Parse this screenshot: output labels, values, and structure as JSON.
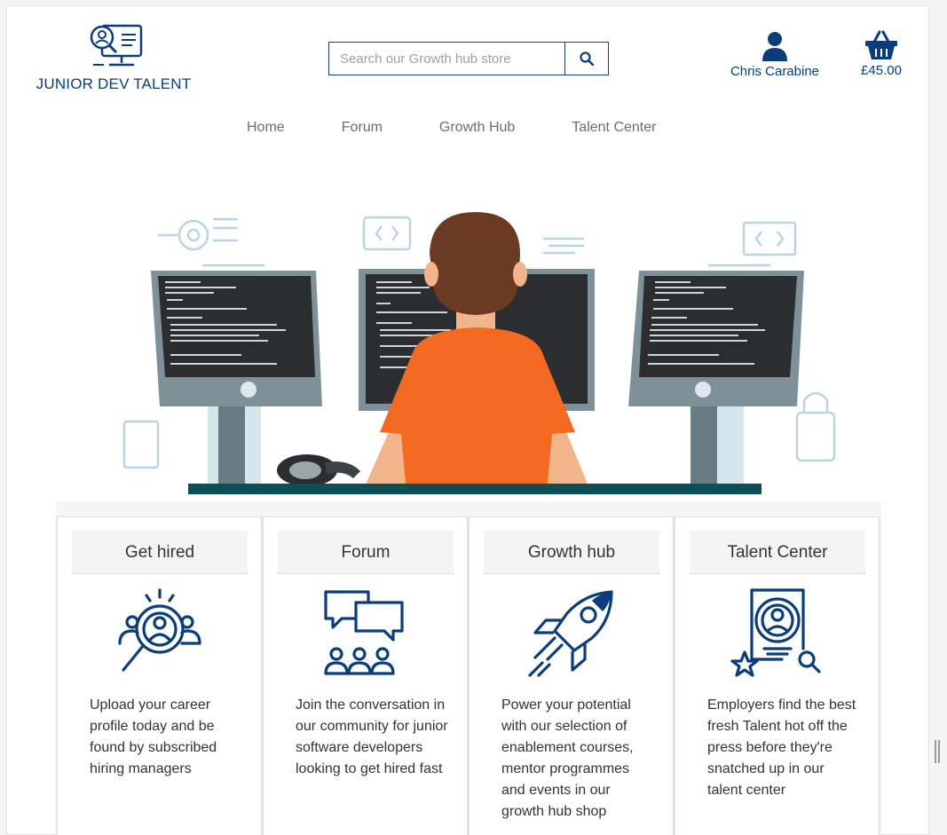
{
  "brand": {
    "name": "JUNIOR DEV TALENT",
    "color": "#0a3d7a"
  },
  "search": {
    "placeholder": "Search our Growth hub store"
  },
  "account": {
    "name": "Chris Carabine"
  },
  "basket": {
    "total": "£45.00"
  },
  "nav": [
    "Home",
    "Forum",
    "Growth Hub",
    "Talent Center"
  ],
  "cards": [
    {
      "title": "Get hired",
      "icon": "search-people-icon",
      "text": "Upload your career profile today and be found by subscribed hiring managers"
    },
    {
      "title": "Forum",
      "icon": "discussion-icon",
      "text": "Join the conversation in our community for junior software developers looking to get hired fast"
    },
    {
      "title": "Growth hub",
      "icon": "rocket-icon",
      "text": "Power your potential with our selection of enablement courses, mentor programmes and events in our growth hub shop"
    },
    {
      "title": "Talent Center",
      "icon": "talent-badge-icon",
      "text": "Employers find the best fresh Talent hot off the press before they're snatched up in our talent center"
    }
  ],
  "colors": {
    "accent": "#0a3d7a",
    "shirt": "#f26a21",
    "hair": "#6b3a22",
    "desk": "#0d4f57"
  }
}
